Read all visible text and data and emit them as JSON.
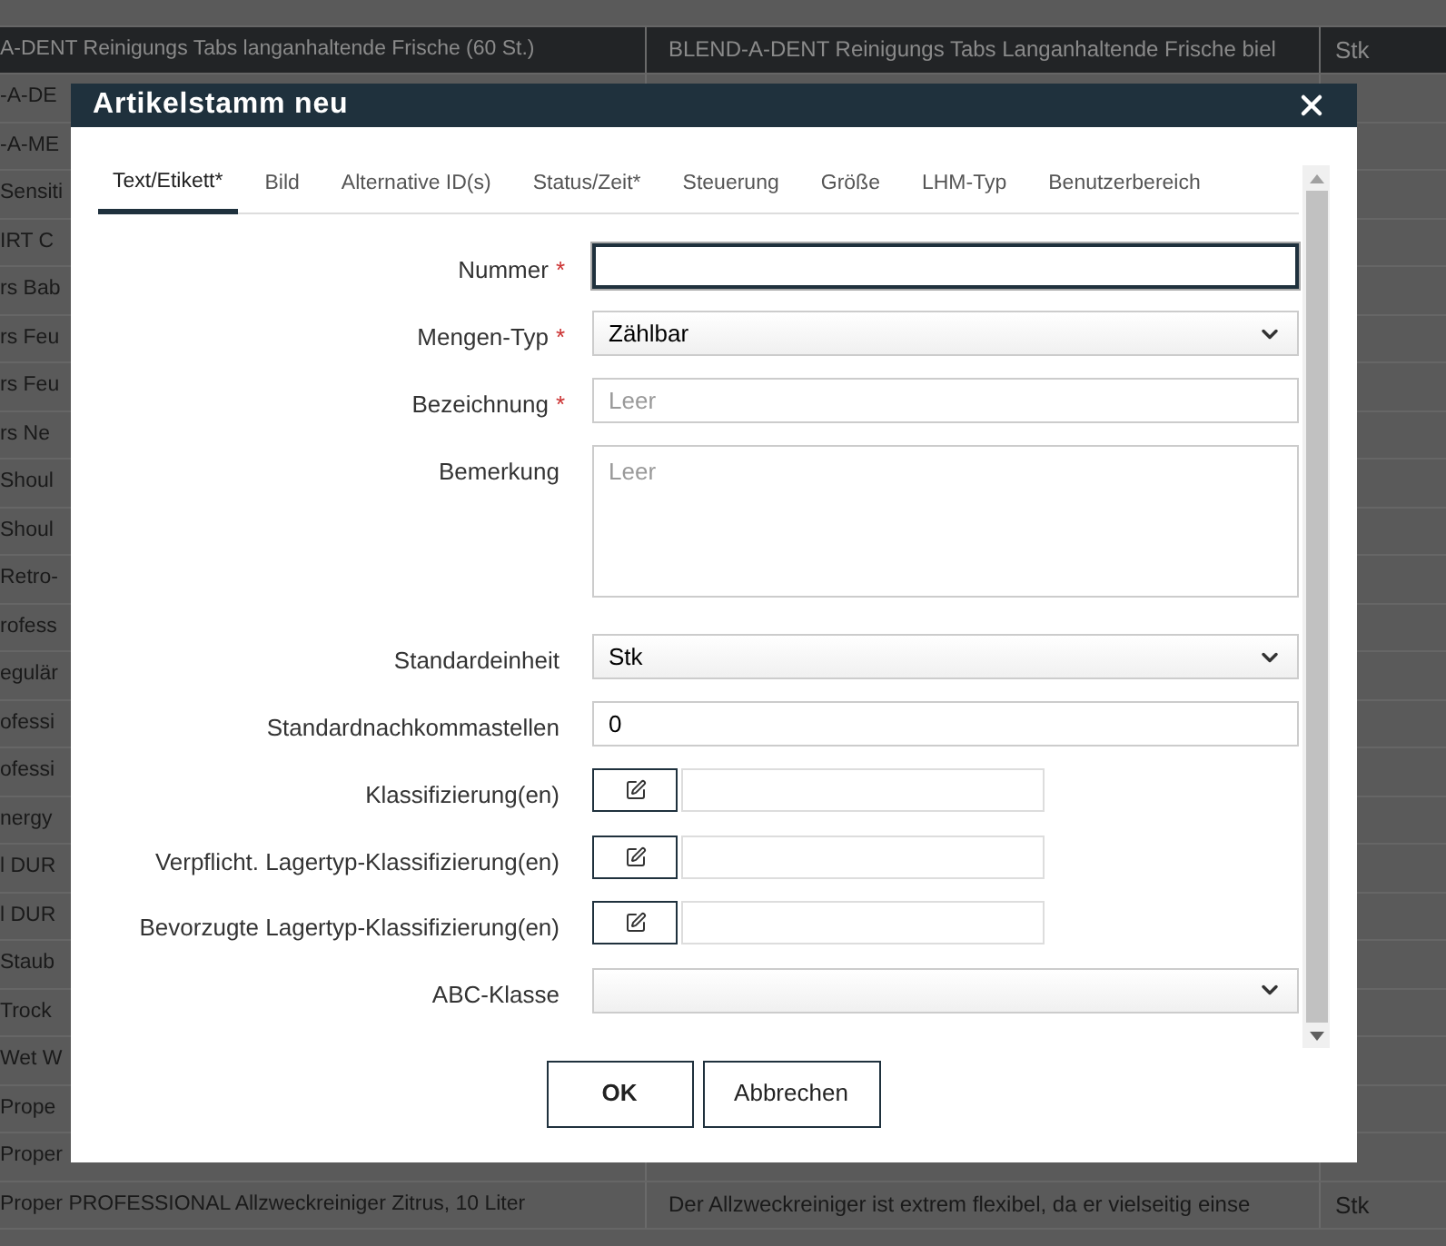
{
  "background_table": {
    "rows": [
      {
        "selected": true,
        "cells": [
          "A-DENT Reinigungs Tabs langanhaltende Frische (60 St.)",
          "BLEND-A-DENT Reinigungs Tabs Langanhaltende Frische biel",
          "Stk"
        ]
      },
      {
        "selected": false,
        "cells": [
          "-A-DE"
        ]
      },
      {
        "selected": false,
        "cells": [
          "-A-ME"
        ]
      },
      {
        "selected": false,
        "cells": [
          "Sensiti"
        ]
      },
      {
        "selected": false,
        "cells": [
          "IRT C"
        ]
      },
      {
        "selected": false,
        "cells": [
          "rs Bab"
        ]
      },
      {
        "selected": false,
        "cells": [
          "rs Feu"
        ]
      },
      {
        "selected": false,
        "cells": [
          "rs Feu"
        ]
      },
      {
        "selected": false,
        "cells": [
          "rs Ne"
        ]
      },
      {
        "selected": false,
        "cells": [
          "Shoul"
        ]
      },
      {
        "selected": false,
        "cells": [
          "Shoul"
        ]
      },
      {
        "selected": false,
        "cells": [
          "Retro-"
        ]
      },
      {
        "selected": false,
        "cells": [
          "rofess"
        ]
      },
      {
        "selected": false,
        "cells": [
          "egulär"
        ]
      },
      {
        "selected": false,
        "cells": [
          "ofessi"
        ]
      },
      {
        "selected": false,
        "cells": [
          "ofessi"
        ]
      },
      {
        "selected": false,
        "cells": [
          "nergy"
        ]
      },
      {
        "selected": false,
        "cells": [
          "l DUR"
        ]
      },
      {
        "selected": false,
        "cells": [
          "l DUR"
        ]
      },
      {
        "selected": false,
        "cells": [
          "Staub"
        ]
      },
      {
        "selected": false,
        "cells": [
          "Trock"
        ]
      },
      {
        "selected": false,
        "cells": [
          "Wet W"
        ]
      },
      {
        "selected": false,
        "cells": [
          "Prope"
        ]
      },
      {
        "selected": false,
        "cells": [
          "Proper"
        ]
      },
      {
        "selected": false,
        "cells": [
          "Proper PROFESSIONAL Allzweckreiniger Zitrus, 10 Liter",
          "Der Allzweckreiniger ist extrem flexibel, da er vielseitig einse",
          "Stk"
        ]
      }
    ]
  },
  "dialog": {
    "title": "Artikelstamm neu",
    "tabs": [
      {
        "label": "Text/Etikett*",
        "selected": true
      },
      {
        "label": "Bild",
        "selected": false
      },
      {
        "label": "Alternative ID(s)",
        "selected": false
      },
      {
        "label": "Status/Zeit*",
        "selected": false
      },
      {
        "label": "Steuerung",
        "selected": false
      },
      {
        "label": "Größe",
        "selected": false
      },
      {
        "label": "LHM-Typ",
        "selected": false
      },
      {
        "label": "Benutzerbereich",
        "selected": false
      }
    ],
    "fields": [
      {
        "kind": "text",
        "label": "Nummer",
        "required_mark": "*",
        "focused": true
      },
      {
        "kind": "select",
        "label": "Mengen-Typ",
        "required_mark": "*",
        "value": "Zählbar"
      },
      {
        "kind": "text",
        "label": "Bezeichnung",
        "required_mark": "*",
        "focused": false,
        "placeholder": "Leer"
      },
      {
        "kind": "textarea",
        "label": "Bemerkung",
        "placeholder": "Leer"
      },
      {
        "kind": "select",
        "label": "Standardeinheit",
        "value": "Stk"
      },
      {
        "kind": "text",
        "label": "Standardnachkommastellen",
        "focused": false,
        "value": "0"
      },
      {
        "kind": "classification",
        "label": "Klassifizierung(en)"
      },
      {
        "kind": "classification",
        "label": "Verpflicht. Lagertyp-Klassifizierung(en)"
      },
      {
        "kind": "classification",
        "label": "Bevorzugte Lagertyp-Klassifizierung(en)"
      },
      {
        "kind": "select",
        "label": "ABC-Klasse"
      }
    ],
    "buttons": [
      {
        "label": "OK",
        "kind": "primary"
      },
      {
        "label": "Abbrechen",
        "kind": "secondary"
      }
    ]
  }
}
